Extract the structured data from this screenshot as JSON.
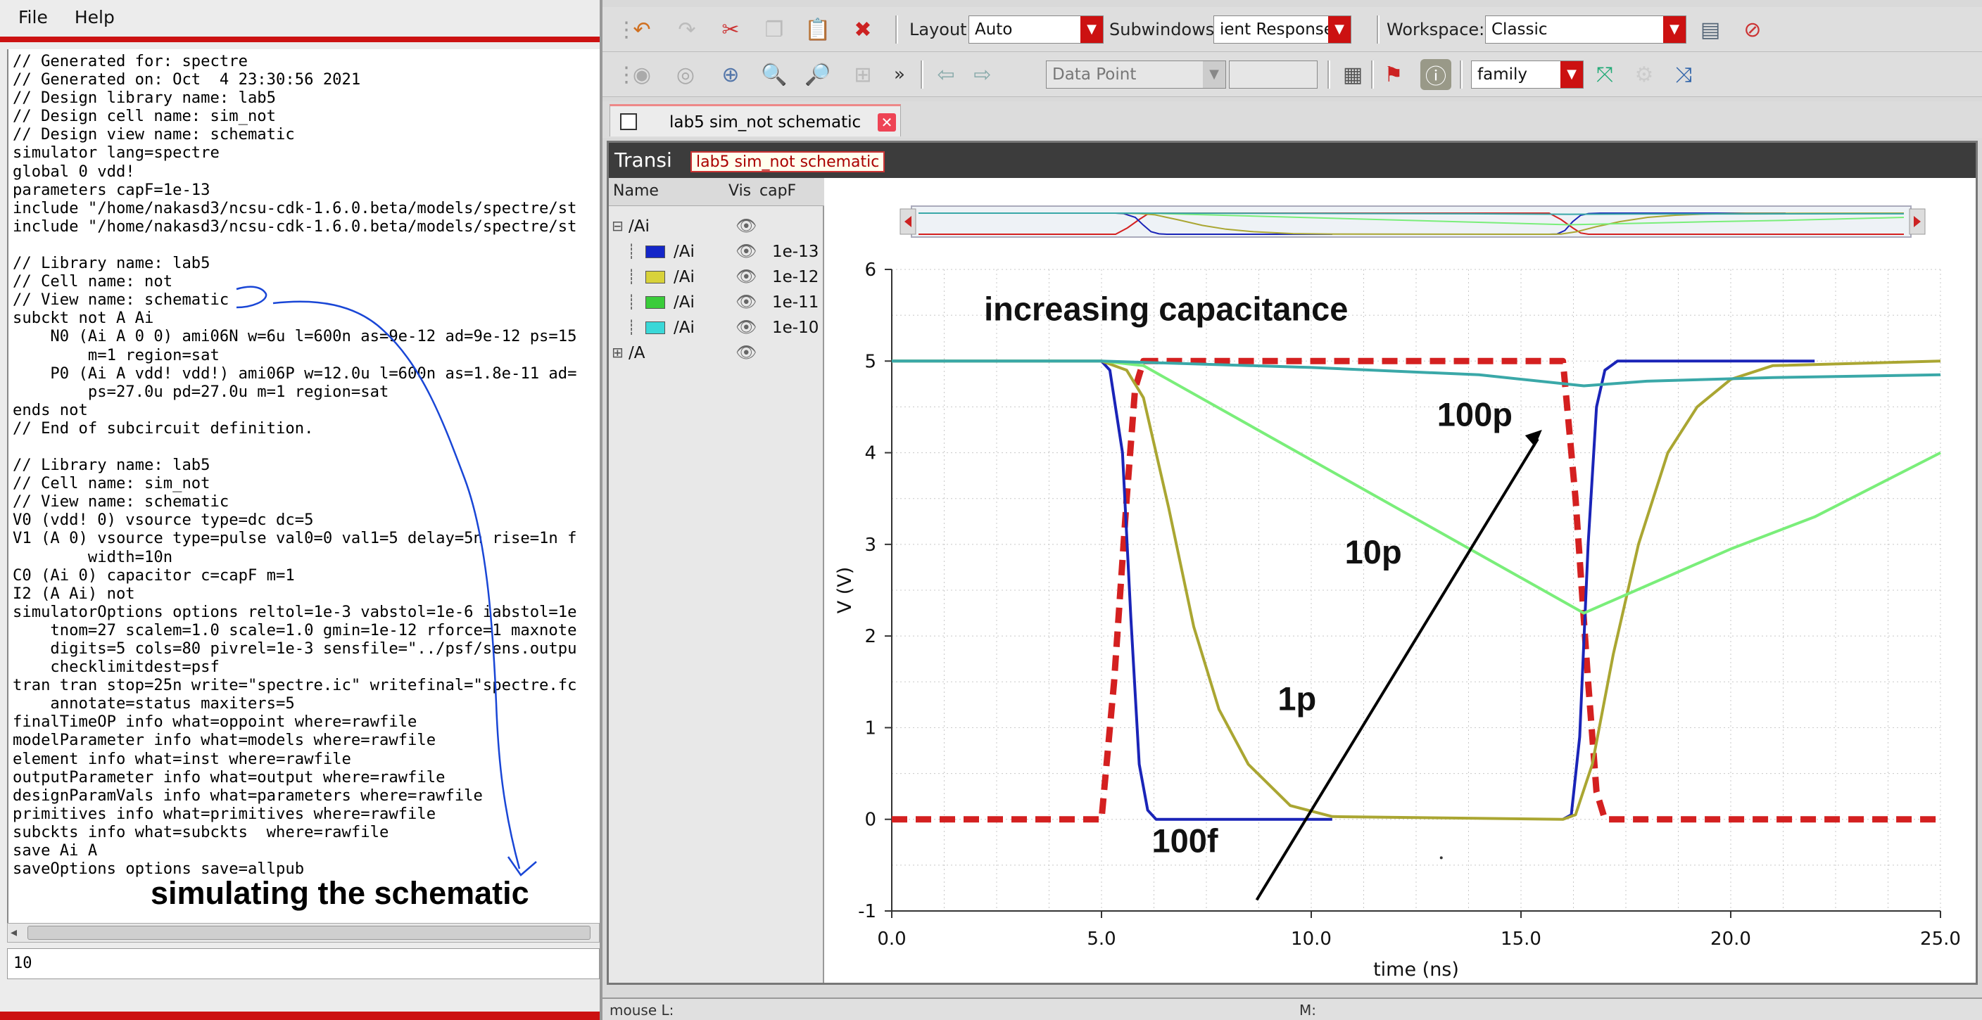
{
  "left_window": {
    "menu": {
      "file": "File",
      "help": "Help"
    },
    "netlist_lines": [
      "// Generated for: spectre",
      "// Generated on: Oct  4 23:30:56 2021",
      "// Design library name: lab5",
      "// Design cell name: sim_not",
      "// Design view name: schematic",
      "simulator lang=spectre",
      "global 0 vdd!",
      "parameters capF=1e-13",
      "include \"/home/nakasd3/ncsu-cdk-1.6.0.beta/models/spectre/st",
      "include \"/home/nakasd3/ncsu-cdk-1.6.0.beta/models/spectre/st",
      "",
      "// Library name: lab5",
      "// Cell name: not",
      "// View name: schematic",
      "subckt not A Ai",
      "    N0 (Ai A 0 0) ami06N w=6u l=600n as=9e-12 ad=9e-12 ps=15",
      "        m=1 region=sat",
      "    P0 (Ai A vdd! vdd!) ami06P w=12.0u l=600n as=1.8e-11 ad=",
      "        ps=27.0u pd=27.0u m=1 region=sat",
      "ends not",
      "// End of subcircuit definition.",
      "",
      "// Library name: lab5",
      "// Cell name: sim_not",
      "// View name: schematic",
      "V0 (vdd! 0) vsource type=dc dc=5",
      "V1 (A 0) vsource type=pulse val0=0 val1=5 delay=5n rise=1n f",
      "        width=10n",
      "C0 (Ai 0) capacitor c=capF m=1",
      "I2 (A Ai) not",
      "simulatorOptions options reltol=1e-3 vabstol=1e-6 iabstol=1e",
      "    tnom=27 scalem=1.0 scale=1.0 gmin=1e-12 rforce=1 maxnote",
      "    digits=5 cols=80 pivrel=1e-3 sensfile=\"../psf/sens.outpu",
      "    checklimitdest=psf",
      "tran tran stop=25n write=\"spectre.ic\" writefinal=\"spectre.fc",
      "    annotate=status maxiters=5",
      "finalTimeOP info what=oppoint where=rawfile",
      "modelParameter info what=models where=rawfile",
      "element info what=inst where=rawfile",
      "outputParameter info what=output where=rawfile",
      "designParamVals info what=parameters where=rawfile",
      "primitives info what=primitives where=rawfile",
      "subckts info what=subckts  where=rawfile",
      "save Ai A",
      "saveOptions options save=allpub"
    ],
    "caption": "simulating the schematic",
    "command_value": "10"
  },
  "toolbar": {
    "layout_label": "Layout:",
    "layout_value": "Auto",
    "subwindows_label": "Subwindows:",
    "subwindows_value": "ient Response",
    "workspace_label": "Workspace:",
    "workspace_value": "Classic",
    "marker_value": "Data Point",
    "family_value": "family"
  },
  "tab": {
    "label": "lab5 sim_not schematic"
  },
  "plot_window": {
    "title": "Transi",
    "tooltip": "lab5 sim_not schematic",
    "legend_headers": {
      "name": "Name",
      "vis": "Vis",
      "capf": "capF"
    },
    "legend_items": [
      {
        "name": "/Ai",
        "value": "",
        "color": ""
      },
      {
        "name": "/Ai",
        "value": "1e-13",
        "color": "#1426c8"
      },
      {
        "name": "/Ai",
        "value": "1e-12",
        "color": "#d8d23a"
      },
      {
        "name": "/Ai",
        "value": "1e-11",
        "color": "#3acc3a"
      },
      {
        "name": "/Ai",
        "value": "1e-10",
        "color": "#3ad8d8"
      },
      {
        "name": "/A",
        "value": "",
        "color": ""
      }
    ]
  },
  "chart_data": {
    "type": "line",
    "xlabel": "time (ns)",
    "ylabel": "V (V)",
    "xlim": [
      0,
      25
    ],
    "ylim": [
      -1,
      6
    ],
    "xticks": [
      "0.0",
      "5.0",
      "10.0",
      "15.0",
      "20.0",
      "25.0"
    ],
    "yticks": [
      "-1",
      "0",
      "1",
      "2",
      "3",
      "4",
      "5",
      "6"
    ],
    "grid": true,
    "annotations": [
      {
        "text": "increasing capacitance",
        "x": 2.2,
        "y": 5.55
      },
      {
        "text": "100p",
        "x": 13.0,
        "y": 4.4
      },
      {
        "text": "10p",
        "x": 10.8,
        "y": 2.9
      },
      {
        "text": "1p",
        "x": 9.2,
        "y": 1.3
      },
      {
        "text": "100f",
        "x": 6.2,
        "y": -0.25
      }
    ],
    "series": [
      {
        "name": "/A",
        "color": "#d42020",
        "dashed": true,
        "x": [
          0,
          5,
          5.3,
          5.6,
          5.8,
          6,
          16,
          16.3,
          16.6,
          16.8,
          17,
          25
        ],
        "y": [
          0,
          0,
          1.5,
          3.5,
          4.7,
          5,
          5,
          3.5,
          1.5,
          0.3,
          0,
          0
        ]
      },
      {
        "name": "/Ai",
        "color": "#1a24b8",
        "dashed": false,
        "x": [
          0,
          5,
          5.2,
          5.5,
          5.7,
          5.9,
          6.1,
          6.3,
          10.5
        ],
        "y": [
          5,
          5,
          4.9,
          4.0,
          2.2,
          0.6,
          0.1,
          0,
          0
        ]
      },
      {
        "name": "/Ai",
        "color": "#1a24b8",
        "dashed": false,
        "x": [
          16,
          16.2,
          16.4,
          16.6,
          16.8,
          17.0,
          17.3,
          22
        ],
        "y": [
          0,
          0.05,
          0.9,
          3.0,
          4.5,
          4.9,
          5,
          5
        ]
      },
      {
        "name": "/Ai",
        "color": "#aaa632",
        "dashed": false,
        "x": [
          0,
          5,
          5.6,
          6,
          6.6,
          7.2,
          7.8,
          8.5,
          9.5,
          10.5,
          16,
          16.3,
          16.7,
          17.2,
          17.8,
          18.5,
          19.2,
          20,
          21,
          25
        ],
        "y": [
          5,
          5,
          4.9,
          4.6,
          3.4,
          2.1,
          1.2,
          0.6,
          0.15,
          0.03,
          0,
          0.05,
          0.6,
          1.8,
          3.0,
          4.0,
          4.5,
          4.8,
          4.95,
          5
        ]
      },
      {
        "name": "/Ai",
        "color": "#7aee7a",
        "dashed": false,
        "x": [
          0,
          5,
          6,
          16.5,
          18,
          20,
          22,
          25
        ],
        "y": [
          5,
          5,
          4.95,
          2.25,
          2.55,
          2.95,
          3.3,
          4.0
        ]
      },
      {
        "name": "/Ai",
        "color": "#3aa8a8",
        "dashed": false,
        "x": [
          0,
          5,
          10,
          14,
          16.5,
          18,
          21,
          25
        ],
        "y": [
          5,
          5,
          4.93,
          4.85,
          4.73,
          4.78,
          4.82,
          4.85
        ]
      }
    ]
  },
  "status": {
    "left": "mouse L:",
    "mid": "M:"
  }
}
